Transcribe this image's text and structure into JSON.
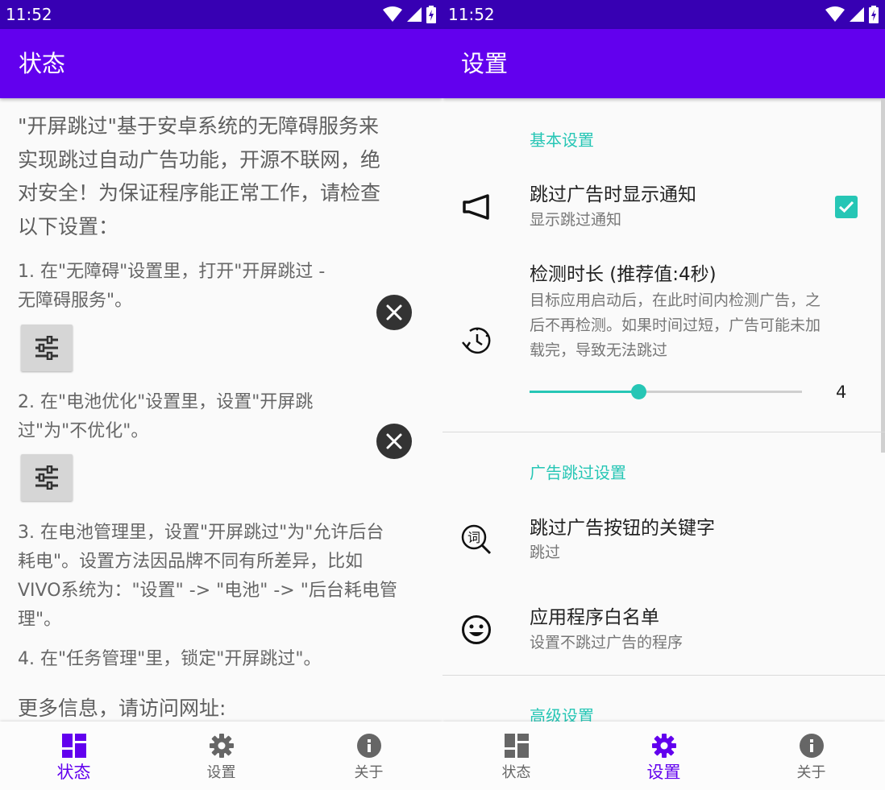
{
  "colors": {
    "status_bar": "#3700b3",
    "app_bar": "#6200ee",
    "accent": "#26c6b5",
    "active_nav": "#6200ee"
  },
  "left": {
    "status": {
      "time": "11:52"
    },
    "app_bar_title": "状态",
    "intro_lines": [
      "\"开屏跳过\"基于安卓系统的无障碍服务来",
      "实现跳过自动广告功能，开源不联网，绝",
      "对安全！为保证程序能正常工作，请检查",
      "以下设置："
    ],
    "steps": {
      "s1": {
        "line1": "1. 在\"无障碍\"设置里，打开\"开屏跳过 -",
        "line2": "无障碍服务\"。",
        "button_icon": "tune-icon",
        "status_icon": "close-icon"
      },
      "s2": {
        "line1": "2. 在\"电池优化\"设置里，设置\"开屏跳",
        "line2": "过\"为\"不优化\"。",
        "button_icon": "tune-icon",
        "status_icon": "close-icon"
      },
      "s3": {
        "line1": "3. 在电池管理里，设置\"开屏跳过\"为\"允许后台",
        "line2": "耗电\"。设置方法因品牌不同有所差异，比如",
        "line3": "VIVO系统为：\"设置\" -> \"电池\" -> \"后台耗电管",
        "line4": "理\"。"
      },
      "s4": {
        "line1": "4. 在\"任务管理\"里，锁定\"开屏跳过\"。"
      }
    },
    "more_info": "更多信息，请访问网址:",
    "bottom_nav": [
      {
        "label": "状态",
        "icon": "dashboard-icon",
        "active": true
      },
      {
        "label": "设置",
        "icon": "gear-icon",
        "active": false
      },
      {
        "label": "关于",
        "icon": "info-icon",
        "active": false
      }
    ]
  },
  "right": {
    "status": {
      "time": "11:52"
    },
    "app_bar_title": "设置",
    "categories": {
      "basic": "基本设置",
      "ad_skip": "广告跳过设置",
      "advanced": "高级设置"
    },
    "prefs": {
      "show_notification": {
        "title": "跳过广告时显示通知",
        "summary": "显示跳过通知",
        "checked": true,
        "icon": "megaphone-icon"
      },
      "detect_duration": {
        "title": "检测时长 (推荐值:4秒)",
        "summary1": "目标应用启动后，在此时间内检测广告，之",
        "summary2": "后不再检测。如果时间过短，广告可能未加",
        "summary3": "载完，导致无法跳过",
        "icon": "timer-icon",
        "value": 4,
        "value_text": "4",
        "max": 10
      },
      "keywords": {
        "title": "跳过广告按钮的关键字",
        "summary": "跳过",
        "icon": "word-search-icon"
      },
      "whitelist": {
        "title": "应用程序白名单",
        "summary": "设置不跳过广告的程序",
        "icon": "smiley-icon"
      }
    },
    "bottom_nav": [
      {
        "label": "状态",
        "icon": "dashboard-icon",
        "active": false
      },
      {
        "label": "设置",
        "icon": "gear-icon",
        "active": true
      },
      {
        "label": "关于",
        "icon": "info-icon",
        "active": false
      }
    ]
  }
}
